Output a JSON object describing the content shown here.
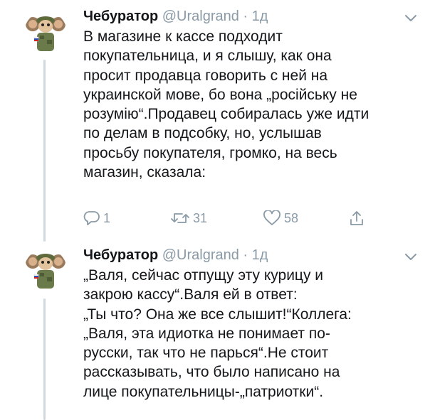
{
  "tweets": [
    {
      "author": {
        "name": "Чебуратор",
        "handle": "@Uralgrand",
        "separator": "·",
        "time": "1д"
      },
      "text_lines": [
        "В магазине к кассе подходит",
        "покупательница, и я слышу, как она",
        "просит продавца говорить с ней на",
        "украинской мове, бо вона „російську не",
        "розумію“.Продавец собиралась уже идти",
        "по делам в подсобку, но, услышав",
        "просьбу покупателя, громко, на весь",
        "магазин, сказала:"
      ],
      "actions": {
        "replies": "1",
        "retweets": "31",
        "likes": "58"
      }
    },
    {
      "author": {
        "name": "Чебуратор",
        "handle": "@Uralgrand",
        "separator": "·",
        "time": "1д"
      },
      "text_lines": [
        "„Валя, сейчас отпущу эту курицу и",
        "закрою кассу“.Валя ей в ответ:",
        "„Ты что? Она же все слышит!“Коллега:",
        "„Валя, эта идиотка не понимает по-",
        "русски, так что не парься“.Не стоит",
        "рассказывать, что было написано на",
        "лице покупательницы-„патриотки“."
      ]
    }
  ],
  "colors": {
    "text": "#14171a",
    "muted": "#8a9aa6",
    "thread_line": "#d1d9de"
  },
  "icons": [
    "avatar-cheburashka-soldier",
    "chevron-down-icon",
    "reply-icon",
    "retweet-icon",
    "like-icon",
    "share-icon"
  ]
}
